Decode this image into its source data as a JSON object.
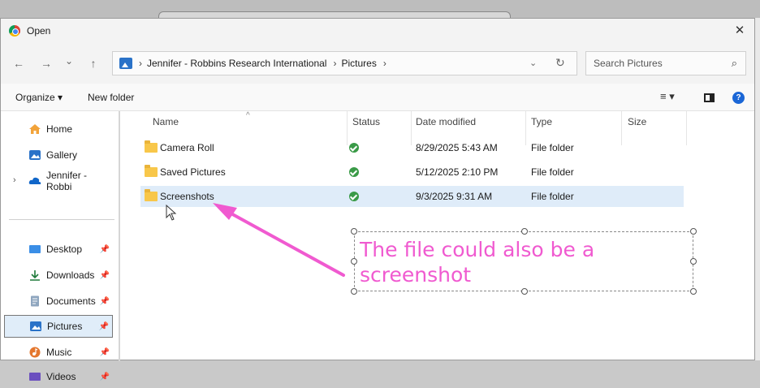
{
  "window": {
    "title": "Open",
    "close_glyph": "✕"
  },
  "nav": {
    "back_glyph": "←",
    "forward_glyph": "→",
    "recent_glyph": "⌄",
    "up_glyph": "↑",
    "breadcrumb": [
      "Jennifer - Robbins Research International",
      "Pictures"
    ],
    "breadcrumb_sep": "›",
    "dropdown_glyph": "⌄",
    "refresh_glyph": "↻"
  },
  "search": {
    "placeholder": "Search Pictures",
    "icon_glyph": "⌕"
  },
  "toolbar": {
    "organize": "Organize ▾",
    "new_folder": "New folder",
    "view_glyph": "≡ ▾",
    "help": "?"
  },
  "sidebar": {
    "expander_glyph": "›",
    "pin_glyph": "📌",
    "items": [
      {
        "label": "Home"
      },
      {
        "label": "Gallery"
      },
      {
        "label": "Jennifer - Robbi"
      },
      {
        "label": "Desktop"
      },
      {
        "label": "Downloads"
      },
      {
        "label": "Documents"
      },
      {
        "label": "Pictures"
      },
      {
        "label": "Music"
      },
      {
        "label": "Videos"
      }
    ]
  },
  "columns": [
    "Name",
    "Status",
    "Date modified",
    "Type",
    "Size"
  ],
  "files": [
    {
      "name": "Camera Roll",
      "date": "8/29/2025 5:43 AM",
      "type": "File folder"
    },
    {
      "name": "Saved Pictures",
      "date": "5/12/2025 2:10 PM",
      "type": "File folder"
    },
    {
      "name": "Screenshots",
      "date": "9/3/2025 9:31 AM",
      "type": "File folder"
    }
  ],
  "annotation": {
    "text": "The file could also be a screenshot",
    "color": "#f05ad0"
  }
}
